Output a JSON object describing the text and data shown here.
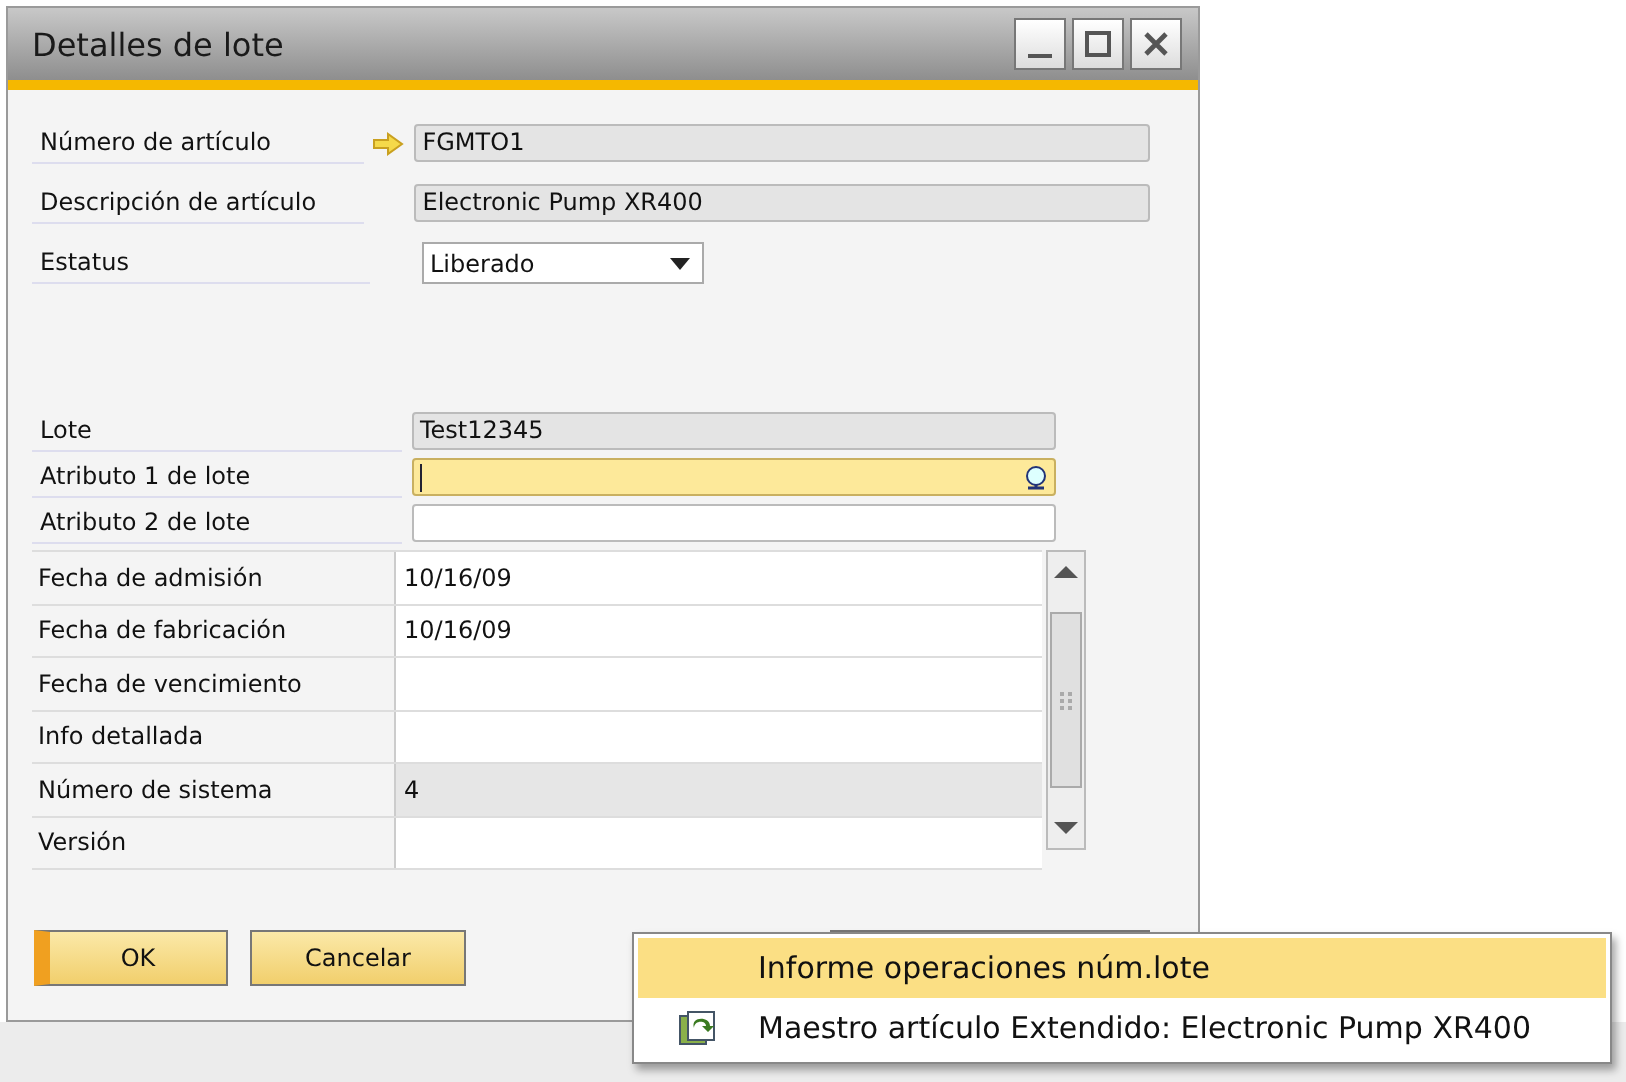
{
  "window": {
    "title": "Detalles de lote"
  },
  "item_fields": [
    {
      "label": "Número de artículo",
      "value": "FGMTO1",
      "kind": "text",
      "readonly": true,
      "link_arrow": true
    },
    {
      "label": "Descripción de artículo",
      "value": "Electronic Pump XR400",
      "kind": "text",
      "readonly": true,
      "link_arrow": false
    },
    {
      "label": "Estatus",
      "value": "Liberado",
      "kind": "dropdown",
      "link_arrow": false
    }
  ],
  "batch_fields": [
    {
      "label": "Lote",
      "value": "Test12345",
      "readonly": true,
      "focused": false
    },
    {
      "label": "Atributo 1 de lote",
      "readonly": false,
      "focused": true
    },
    {
      "label": "Atributo 2 de lote",
      "readonly": false,
      "focused": false
    }
  ],
  "details_grid": [
    {
      "label": "Fecha de admisión",
      "value": "10/16/09",
      "readonly": false
    },
    {
      "label": "Fecha de fabricación",
      "value": "10/16/09",
      "readonly": false
    },
    {
      "label": "Fecha de vencimiento",
      "readonly": false
    },
    {
      "label": "Info detallada",
      "readonly": false
    },
    {
      "label": "Número de sistema",
      "value": "4",
      "readonly": true
    },
    {
      "label": "Versión",
      "readonly": false
    }
  ],
  "buttons": [
    {
      "label": "OK",
      "default": true
    },
    {
      "label": "Cancelar",
      "default": false
    }
  ],
  "context_menu": [
    {
      "label": "Informe operaciones núm.lote",
      "selected": true,
      "kind": "plain"
    },
    {
      "label": "Maestro artículo Extendido: Electronic Pump XR400",
      "selected": false,
      "kind": "linked"
    }
  ]
}
